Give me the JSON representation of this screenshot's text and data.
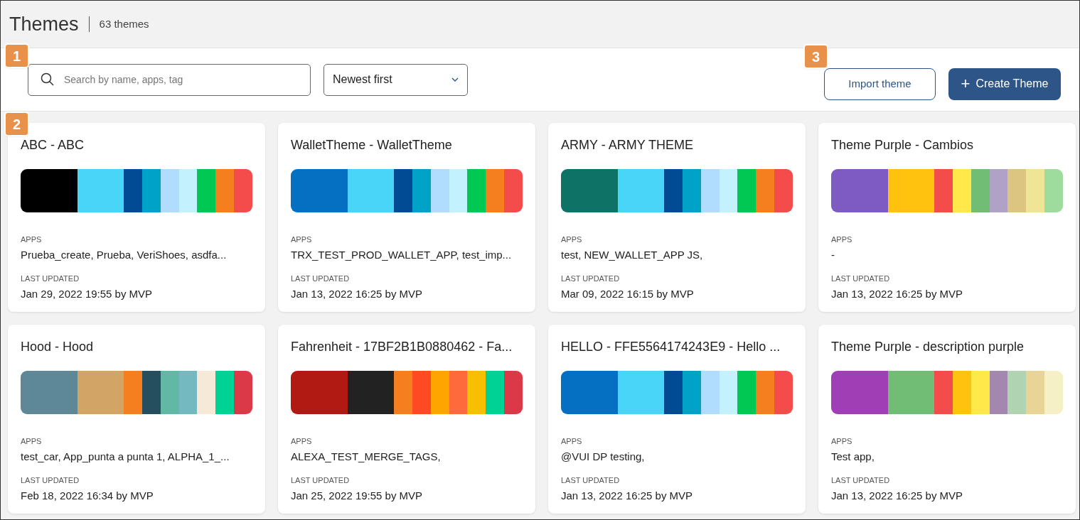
{
  "header": {
    "title": "Themes",
    "count": "63 themes"
  },
  "toolbar": {
    "search": {
      "placeholder": "Search by name, apps, tag"
    },
    "sort": {
      "value": "Newest first"
    },
    "buttons": [
      {
        "kind": "outline",
        "label": "Import theme"
      },
      {
        "kind": "primary",
        "icon": "+",
        "label": "Create Theme"
      }
    ]
  },
  "callouts": [
    "1",
    "2",
    "3"
  ],
  "themes": [
    {
      "title": "ABC  - ABC",
      "swatches": [
        {
          "color": "#000000"
        },
        {
          "color": "#48d5f7"
        },
        {
          "color": "#004b93"
        },
        {
          "color": "#00a2c7"
        },
        {
          "color": "#b0dcfd"
        },
        {
          "color": "#c3f1fd"
        },
        {
          "color": "#00c853"
        },
        {
          "color": "#f57f1e"
        },
        {
          "color": "#f44b4b"
        }
      ],
      "apps_label": "APPS",
      "apps": "Prueba_create, Prueba, VeriShoes, asdfa...",
      "updated_label": "LAST UPDATED",
      "updated": "Jan 29, 2022 19:55 by MVP"
    },
    {
      "title": "WalletTheme -  WalletTheme",
      "swatches": [
        {
          "color": "#0570c2"
        },
        {
          "color": "#48d5f7"
        },
        {
          "color": "#004b93"
        },
        {
          "color": "#00a2c7"
        },
        {
          "color": "#b0dcfd"
        },
        {
          "color": "#c3f1fd"
        },
        {
          "color": "#00c853"
        },
        {
          "color": "#f57f1e"
        },
        {
          "color": "#f44b4b"
        }
      ],
      "apps_label": "APPS",
      "apps": "TRX_TEST_PROD_WALLET_APP, test_imp...",
      "updated_label": "LAST UPDATED",
      "updated": "Jan 13, 2022 16:25 by MVP"
    },
    {
      "title": "ARMY - ARMY THEME",
      "swatches": [
        {
          "color": "#0e7366"
        },
        {
          "color": "#48d5f7"
        },
        {
          "color": "#004b93"
        },
        {
          "color": "#00a2c7"
        },
        {
          "color": "#b0dcfd"
        },
        {
          "color": "#c3f1fd"
        },
        {
          "color": "#00c853"
        },
        {
          "color": "#f57f1e"
        },
        {
          "color": "#f44b4b"
        }
      ],
      "apps_label": "APPS",
      "apps": "test, NEW_WALLET_APP JS,",
      "updated_label": "LAST UPDATED",
      "updated": "Mar 09, 2022 16:15 by MVP"
    },
    {
      "title": "Theme Purple - Cambios",
      "swatches": [
        {
          "color": "#7e5bc2"
        },
        {
          "color": "#ffc20e"
        },
        {
          "color": "#f44b4b"
        },
        {
          "color": "#ffe94a"
        },
        {
          "color": "#71bd76"
        },
        {
          "color": "#b0a2c7"
        },
        {
          "color": "#dcc580"
        },
        {
          "color": "#f0e596"
        },
        {
          "color": "#9edc9d"
        }
      ],
      "apps_label": "APPS",
      "apps": "-",
      "updated_label": "LAST UPDATED",
      "updated": "Jan 13, 2022 16:25 by MVP"
    },
    {
      "title": "Hood - Hood",
      "swatches": [
        {
          "color": "#5e8797"
        },
        {
          "color": "#d2a465"
        },
        {
          "color": "#f57f1e"
        },
        {
          "color": "#254e5e"
        },
        {
          "color": "#62b8a5"
        },
        {
          "color": "#74b9c0"
        },
        {
          "color": "#f7e9d7"
        },
        {
          "color": "#00d295"
        },
        {
          "color": "#db3848"
        }
      ],
      "apps_label": "APPS",
      "apps": "test_car, App_punta a punta 1, ALPHA_1_...",
      "updated_label": "LAST UPDATED",
      "updated": "Feb 18, 2022 16:34 by MVP"
    },
    {
      "title": "Fahrenheit - 17BF2B1B0880462 - Fa...",
      "swatches": [
        {
          "color": "#b01a12"
        },
        {
          "color": "#222222"
        },
        {
          "color": "#f57f1e"
        },
        {
          "color": "#ff4a24"
        },
        {
          "color": "#ffa500"
        },
        {
          "color": "#ff6a3c"
        },
        {
          "color": "#f8be00"
        },
        {
          "color": "#00d295"
        },
        {
          "color": "#db3848"
        }
      ],
      "apps_label": "APPS",
      "apps": "ALEXA_TEST_MERGE_TAGS,",
      "updated_label": "LAST UPDATED",
      "updated": "Jan 25, 2022 19:55 by MVP"
    },
    {
      "title": "HELLO - FFE5564174243E9 - Hello ...",
      "swatches": [
        {
          "color": "#0570c2"
        },
        {
          "color": "#48d5f7"
        },
        {
          "color": "#004b93"
        },
        {
          "color": "#00a2c7"
        },
        {
          "color": "#b0dcfd"
        },
        {
          "color": "#c3f1fd"
        },
        {
          "color": "#00c853"
        },
        {
          "color": "#f57f1e"
        },
        {
          "color": "#f44b4b"
        }
      ],
      "apps_label": "APPS",
      "apps": "@VUI DP testing,",
      "updated_label": "LAST UPDATED",
      "updated": "Jan 13, 2022 16:25 by MVP"
    },
    {
      "title": "Theme Purple - description purple",
      "swatches": [
        {
          "color": "#a03fb5"
        },
        {
          "color": "#71bd76"
        },
        {
          "color": "#f44b4b"
        },
        {
          "color": "#ffc20e"
        },
        {
          "color": "#ffe94a"
        },
        {
          "color": "#a487ae"
        },
        {
          "color": "#b0d3b1"
        },
        {
          "color": "#e8d496"
        },
        {
          "color": "#f5f0c6"
        }
      ],
      "apps_label": "APPS",
      "apps": "Test app,",
      "updated_label": "LAST UPDATED",
      "updated": "Jan 13, 2022 16:25 by MVP"
    }
  ]
}
